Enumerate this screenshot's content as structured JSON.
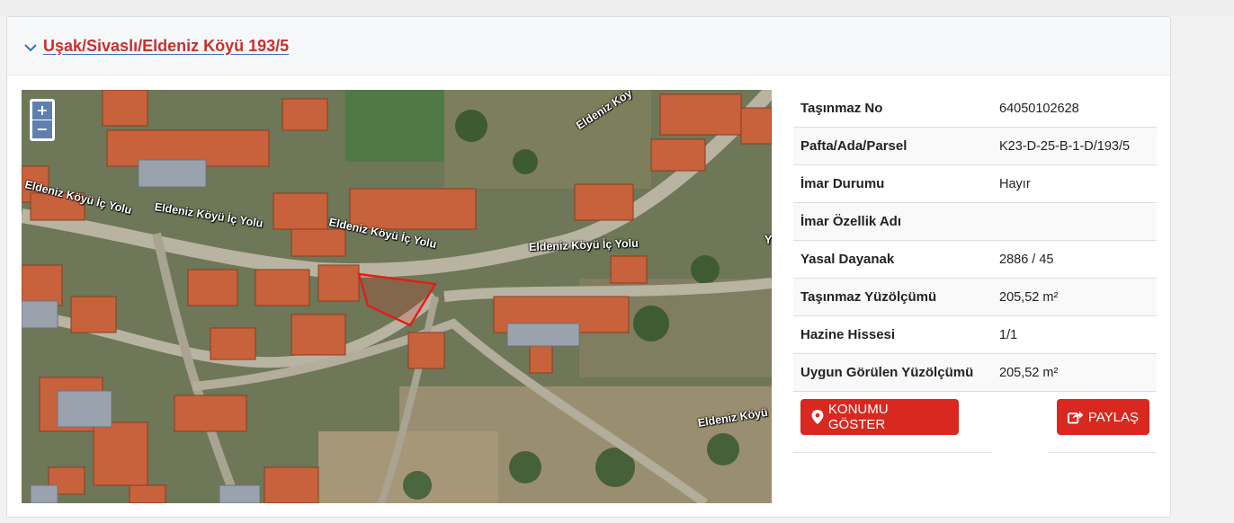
{
  "header": {
    "title": "Uşak/Sivaslı/Eldeniz Köyü 193/5"
  },
  "map": {
    "zoom_in": "+",
    "zoom_out": "−",
    "road_labels": [
      "Eldeniz Köyü İç Yolu",
      "Eldeniz Köyü İç Yolu",
      "Eldeniz Köyü İç Yolu",
      "Eldeniz Köyü İç Yolu",
      "Eldeniz Köy",
      "Eldeniz Köyü",
      "Y"
    ],
    "parcel_color": "#e0201a"
  },
  "info": {
    "rows": [
      {
        "label": "Taşınmaz No",
        "value": "64050102628"
      },
      {
        "label": "Pafta/Ada/Parsel",
        "value": "K23-D-25-B-1-D/193/5"
      },
      {
        "label": "İmar Durumu",
        "value": "Hayır"
      },
      {
        "label": "İmar Özellik Adı",
        "value": ""
      },
      {
        "label": "Yasal Dayanak",
        "value": "2886 / 45"
      },
      {
        "label": "Taşınmaz Yüzölçümü",
        "value": "205,52 m²"
      },
      {
        "label": "Hazine Hissesi",
        "value": "1/1"
      },
      {
        "label": "Uygun Görülen Yüzölçümü",
        "value": "205,52 m²"
      }
    ]
  },
  "buttons": {
    "show_location": "KONUMU GÖSTER",
    "share": "PAYLAŞ"
  },
  "colors": {
    "accent_red": "#d9281f",
    "title_red": "#c9302c"
  }
}
